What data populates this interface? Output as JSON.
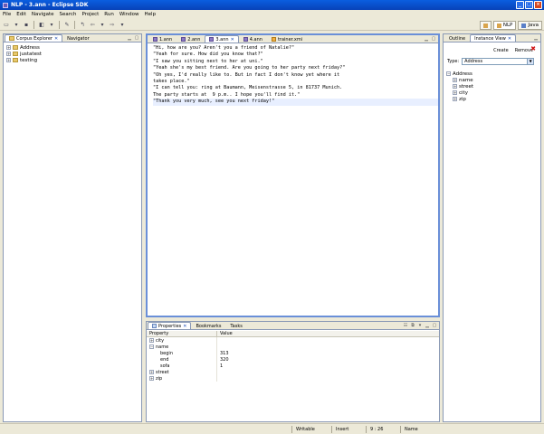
{
  "window": {
    "title": "NLP - 3.ann - Eclipse SDK"
  },
  "menu": [
    "File",
    "Edit",
    "Navigate",
    "Search",
    "Project",
    "Run",
    "Window",
    "Help"
  ],
  "perspectives": [
    {
      "label": "NLP",
      "active": true
    },
    {
      "label": "Java",
      "active": false
    }
  ],
  "left_panel": {
    "tabs": [
      {
        "label": "Corpus Explorer",
        "active": true
      },
      {
        "label": "Navigator",
        "active": false
      }
    ],
    "tree": [
      "Address",
      "justatest",
      "testing"
    ]
  },
  "editor": {
    "tabs": [
      {
        "label": "1.ann",
        "active": false,
        "kind": "ann"
      },
      {
        "label": "2.ann",
        "active": false,
        "kind": "ann"
      },
      {
        "label": "3.ann",
        "active": true,
        "kind": "ann"
      },
      {
        "label": "4.ann",
        "active": false,
        "kind": "ann"
      },
      {
        "label": "trainer.xmi",
        "active": false,
        "kind": "xml"
      }
    ],
    "lines": [
      "\"Hi, how are you? Aren't you a friend of Natalie?\"",
      "\"Yeah for sure. How did you know that?\"",
      "\"I saw you sitting next to her at uni.\"",
      "\"Yeah she's my best friend. Are you going to her party next friday?\"",
      "\"Oh yes, I'd really like to. But in fact I don't know yet where it",
      "takes place.\"",
      "\"I can tell you: ring at Baumann, Meisenstrasse 5, in 81737 Munich.",
      "The party starts at  9 p.m.. I hope you'll find it.\"",
      "\"Thank you very much, see you next friday!\""
    ]
  },
  "properties": {
    "tabs": [
      {
        "label": "Properties",
        "active": true
      },
      {
        "label": "Bookmarks",
        "active": false
      },
      {
        "label": "Tasks",
        "active": false
      }
    ],
    "columns": [
      "Property",
      "Value"
    ],
    "rows": [
      {
        "prop": "city",
        "value": "",
        "indent": 0,
        "toggle": "+"
      },
      {
        "prop": "name",
        "value": "",
        "indent": 0,
        "toggle": "-"
      },
      {
        "prop": "begin",
        "value": "313",
        "indent": 1,
        "toggle": ""
      },
      {
        "prop": "end",
        "value": "320",
        "indent": 1,
        "toggle": ""
      },
      {
        "prop": "sofa",
        "value": "1",
        "indent": 1,
        "toggle": ""
      },
      {
        "prop": "street",
        "value": "",
        "indent": 0,
        "toggle": "+"
      },
      {
        "prop": "zip",
        "value": "",
        "indent": 0,
        "toggle": "+"
      }
    ]
  },
  "right_panel": {
    "tabs": [
      {
        "label": "Outline",
        "active": false
      },
      {
        "label": "Instance View",
        "active": true
      }
    ],
    "create_label": "Create",
    "remove_label": "Remove",
    "type_label": "Type:",
    "type_value": "Address",
    "tree_root": "Address",
    "tree_children": [
      "name",
      "street",
      "city",
      "zip"
    ]
  },
  "status": {
    "mode": "Writable",
    "insert": "Insert",
    "position": "9 : 26",
    "type": "Name"
  },
  "colors": {
    "title_bar": "#0a5ee0",
    "editor_border": "#6a8fd8",
    "remove_x": "#d01010"
  }
}
